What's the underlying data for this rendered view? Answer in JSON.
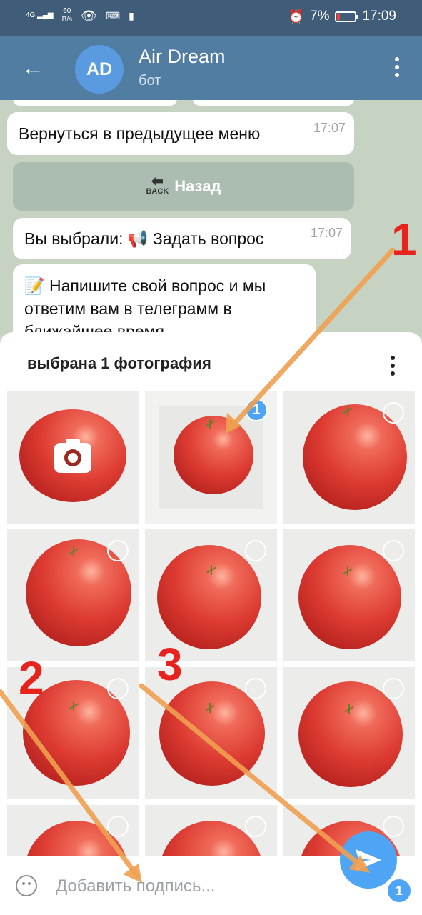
{
  "status_bar": {
    "net_type": "4G",
    "speed": "60",
    "speed_unit": "B/s",
    "battery": "7%",
    "time": "17:09"
  },
  "header": {
    "avatar_initials": "AD",
    "title": "Air Dream",
    "subtitle": "бот"
  },
  "chat": {
    "messages": [
      {
        "text": "Вернуться в предыдущее меню",
        "time": "17:07"
      },
      {
        "text": "Вы выбрали: 📢 Задать вопрос",
        "time": "17:07"
      },
      {
        "text": "📝 Напишите свой вопрос и мы ответим вам в телеграмм в ближайшее время"
      }
    ],
    "keyboard_button": {
      "icon_label": "BACK",
      "label": "Назад"
    }
  },
  "picker": {
    "title": "выбрана 1 фотография",
    "selected_count": "1",
    "caption_placeholder": "Добавить подпись...",
    "send_badge": "1"
  },
  "annotations": {
    "one": "1",
    "two": "2",
    "three": "3"
  },
  "colors": {
    "accent": "#4ea4f5",
    "header": "#517da2",
    "status_bar": "#3f5d79",
    "annotation": "#e8221c",
    "arrow": "#f0a050"
  },
  "icons": [
    "back-arrow-icon",
    "more-vertical-icon",
    "camera-icon",
    "emoji-icon",
    "send-icon"
  ]
}
